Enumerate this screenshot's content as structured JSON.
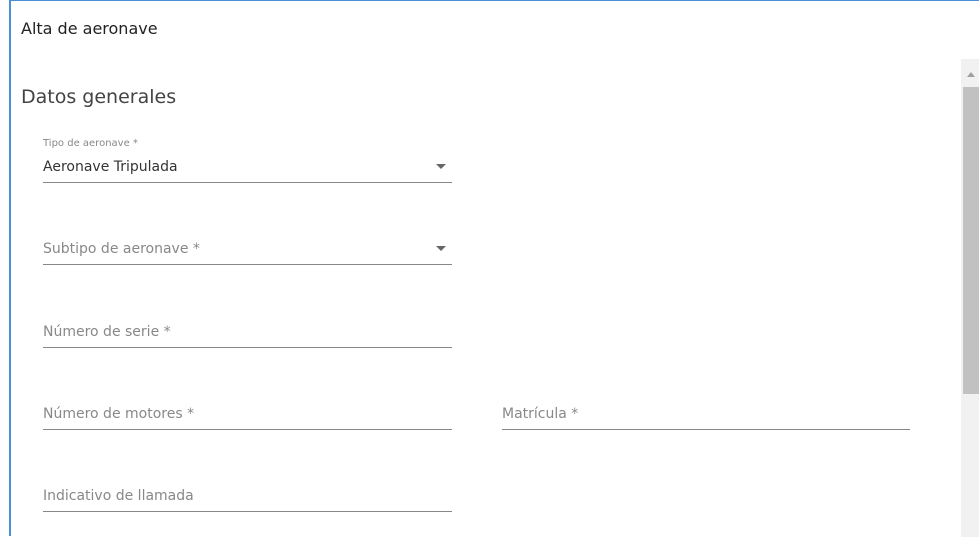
{
  "dialog": {
    "title": "Alta de aeronave"
  },
  "section": {
    "title": "Datos generales"
  },
  "fields": {
    "tipo_aeronave": {
      "label": "Tipo de aeronave *",
      "value": "Aeronave Tripulada",
      "icon": "caret-down-icon"
    },
    "subtipo_aeronave": {
      "placeholder": "Subtipo de aeronave *",
      "icon": "caret-down-icon"
    },
    "numero_serie": {
      "placeholder": "Número de serie *"
    },
    "numero_motores": {
      "placeholder": "Número de motores *"
    },
    "matricula": {
      "placeholder": "Matrícula *"
    },
    "indicativo_llamada": {
      "placeholder": "Indicativo de llamada"
    }
  },
  "colors": {
    "accent_border": "#4a90d9",
    "underline": "#888888",
    "scroll_thumb": "#c1c1c1"
  }
}
